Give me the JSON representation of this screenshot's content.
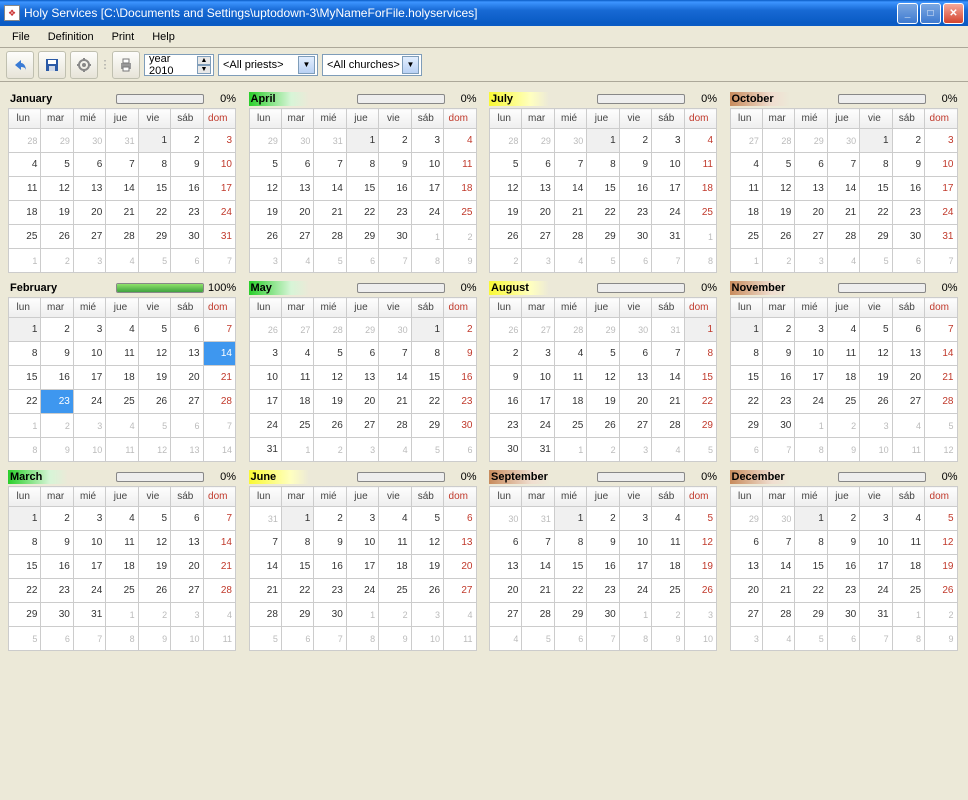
{
  "window": {
    "title": "Holy Services  [C:\\Documents and Settings\\uptodown-3\\MyNameForFile.holyservices]"
  },
  "menu": {
    "file": "File",
    "definition": "Definition",
    "print": "Print",
    "help": "Help"
  },
  "toolbar": {
    "year_label": "year 2010",
    "priests": "<All priests>",
    "churches": "<All churches>"
  },
  "days": [
    "lun",
    "mar",
    "mié",
    "jue",
    "vie",
    "sáb",
    "dom"
  ],
  "months": [
    {
      "name": "January",
      "color": "",
      "pct": "0%",
      "fill": 0,
      "start": 4,
      "len": 31,
      "prev": 31
    },
    {
      "name": "April",
      "color": "green",
      "pct": "0%",
      "fill": 0,
      "start": 3,
      "len": 30,
      "prev": 31
    },
    {
      "name": "July",
      "color": "yellow",
      "pct": "0%",
      "fill": 0,
      "start": 3,
      "len": 31,
      "prev": 30
    },
    {
      "name": "October",
      "color": "brown",
      "pct": "0%",
      "fill": 0,
      "start": 4,
      "len": 31,
      "prev": 30
    },
    {
      "name": "February",
      "color": "",
      "pct": "100%",
      "fill": 100,
      "start": 0,
      "len": 28,
      "prev": 31,
      "selected": [
        14,
        23
      ]
    },
    {
      "name": "May",
      "color": "green",
      "pct": "0%",
      "fill": 0,
      "start": 5,
      "len": 31,
      "prev": 30
    },
    {
      "name": "August",
      "color": "yellow",
      "pct": "0%",
      "fill": 0,
      "start": 6,
      "len": 31,
      "prev": 31
    },
    {
      "name": "November",
      "color": "brown",
      "pct": "0%",
      "fill": 0,
      "start": 0,
      "len": 30,
      "prev": 31
    },
    {
      "name": "March",
      "color": "green",
      "pct": "0%",
      "fill": 0,
      "start": 0,
      "len": 31,
      "prev": 28
    },
    {
      "name": "June",
      "color": "yellow",
      "pct": "0%",
      "fill": 0,
      "start": 1,
      "len": 30,
      "prev": 31
    },
    {
      "name": "September",
      "color": "brown",
      "pct": "0%",
      "fill": 0,
      "start": 2,
      "len": 30,
      "prev": 31
    },
    {
      "name": "December",
      "color": "brown",
      "pct": "0%",
      "fill": 0,
      "start": 2,
      "len": 31,
      "prev": 30
    }
  ]
}
